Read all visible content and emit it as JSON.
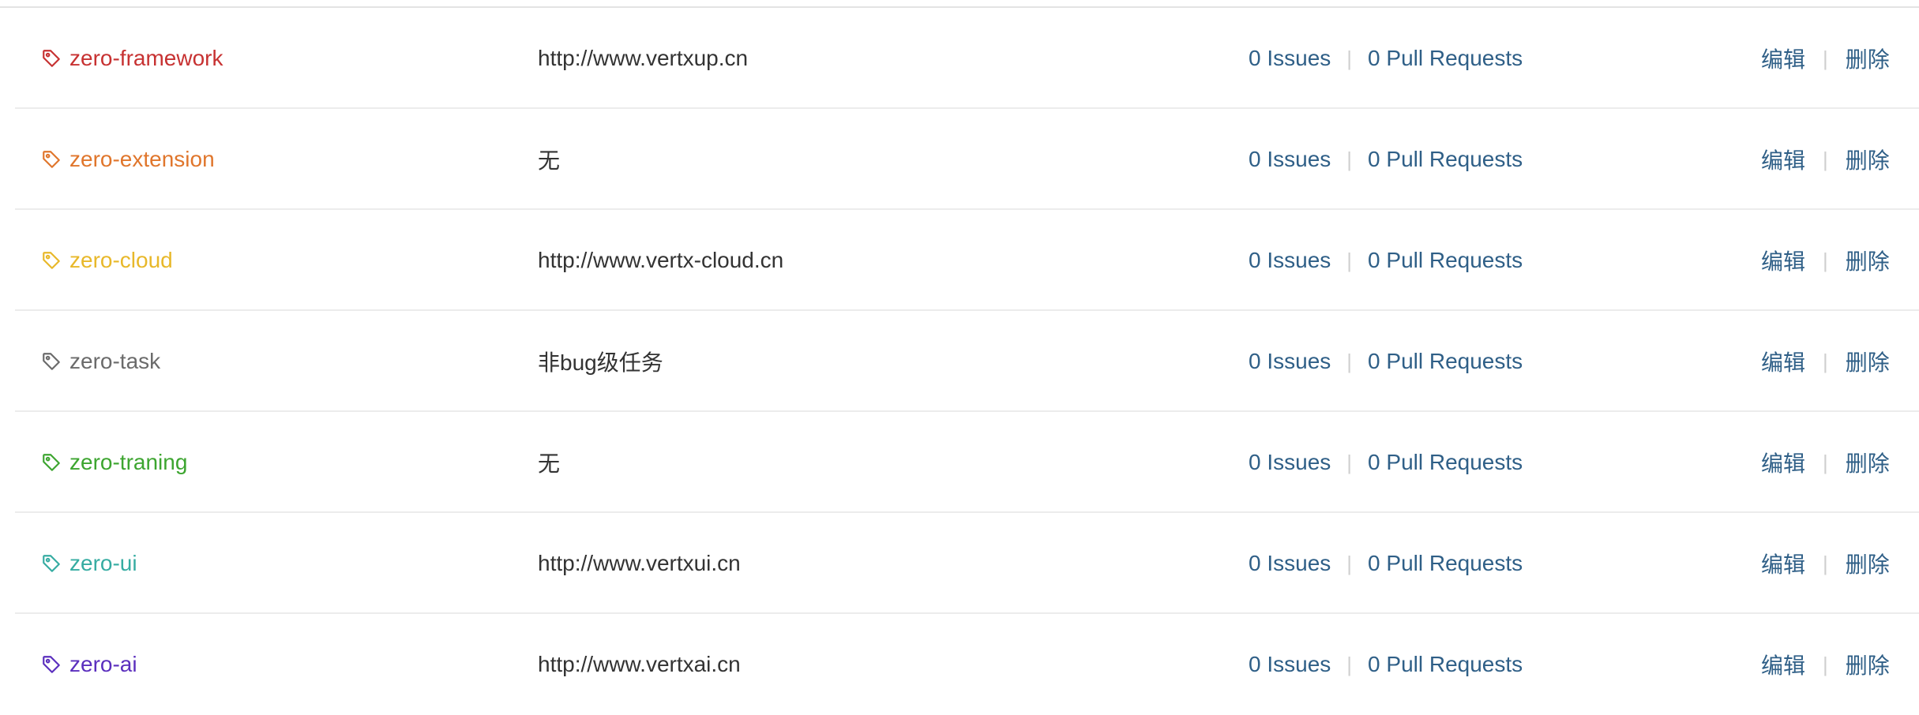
{
  "labels": [
    {
      "name": "zero-framework",
      "color": "#c73232",
      "description": "http://www.vertxup.cn",
      "issues": "0 Issues",
      "pull_requests": "0 Pull Requests",
      "edit": "编辑",
      "delete": "删除",
      "icon": "tag-icon"
    },
    {
      "name": "zero-extension",
      "color": "#e0762c",
      "description": "无",
      "issues": "0 Issues",
      "pull_requests": "0 Pull Requests",
      "edit": "编辑",
      "delete": "删除",
      "icon": "tag-icon"
    },
    {
      "name": "zero-cloud",
      "color": "#e8b82a",
      "description": "http://www.vertx-cloud.cn",
      "issues": "0 Issues",
      "pull_requests": "0 Pull Requests",
      "edit": "编辑",
      "delete": "删除",
      "icon": "tag-icon"
    },
    {
      "name": "zero-task",
      "color": "#6b6b6b",
      "description": "非bug级任务",
      "issues": "0 Issues",
      "pull_requests": "0 Pull Requests",
      "edit": "编辑",
      "delete": "删除",
      "icon": "tag-icon"
    },
    {
      "name": "zero-traning",
      "color": "#3da530",
      "description": "无",
      "issues": "0 Issues",
      "pull_requests": "0 Pull Requests",
      "edit": "编辑",
      "delete": "删除",
      "icon": "tag-icon"
    },
    {
      "name": "zero-ui",
      "color": "#36aca2",
      "description": "http://www.vertxui.cn",
      "issues": "0 Issues",
      "pull_requests": "0 Pull Requests",
      "edit": "编辑",
      "delete": "删除",
      "icon": "tag-icon"
    },
    {
      "name": "zero-ai",
      "color": "#5b2fbe",
      "description": "http://www.vertxai.cn",
      "issues": "0 Issues",
      "pull_requests": "0 Pull Requests",
      "edit": "编辑",
      "delete": "删除",
      "icon": "tag-icon"
    }
  ],
  "separator": "|"
}
